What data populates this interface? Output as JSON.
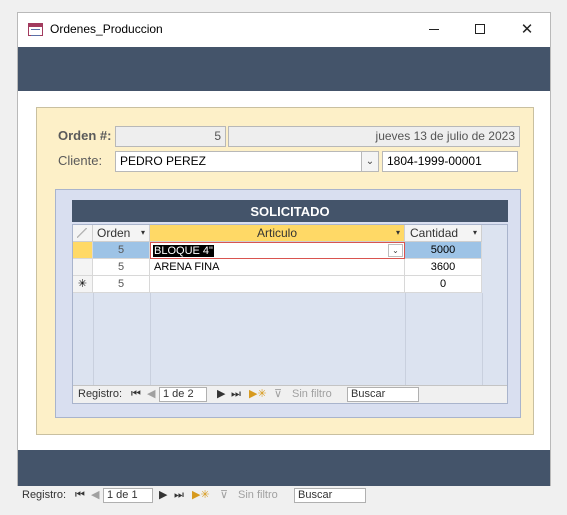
{
  "window": {
    "title": "Ordenes_Produccion",
    "minimize_icon": "minimize-icon",
    "maximize_icon": "maximize-icon",
    "close_icon": "close-icon"
  },
  "form": {
    "orden_label": "Orden #:",
    "orden_value": "5",
    "fecha_value": "jueves 13 de julio de 2023",
    "cliente_label": "Cliente:",
    "cliente_value": "PEDRO PEREZ",
    "rnc_value": "1804-1999-00001"
  },
  "subform": {
    "title": "SOLICITADO",
    "columns": [
      "Orden",
      "Articulo",
      "Cantidad"
    ],
    "rows": [
      {
        "orden": "5",
        "articulo": "BLOQUE 4\"",
        "cantidad": "5000"
      },
      {
        "orden": "5",
        "articulo": "ARENA FINA",
        "cantidad": "3600"
      }
    ],
    "new_row": {
      "marker": "✳",
      "orden": "5",
      "cantidad": "0"
    },
    "nav": {
      "label": "Registro:",
      "position": "1 de 2",
      "filter": "Sin filtro",
      "search": "Buscar"
    }
  },
  "main_nav": {
    "label": "Registro:",
    "position": "1 de 1",
    "filter": "Sin filtro",
    "search": "Buscar"
  },
  "colors": {
    "band": "#44546a",
    "detail_bg": "#fdf0c8",
    "subform_bg": "#d9dff0",
    "highlight": "#ffd966",
    "selected_cell": "#9dc3e6"
  }
}
